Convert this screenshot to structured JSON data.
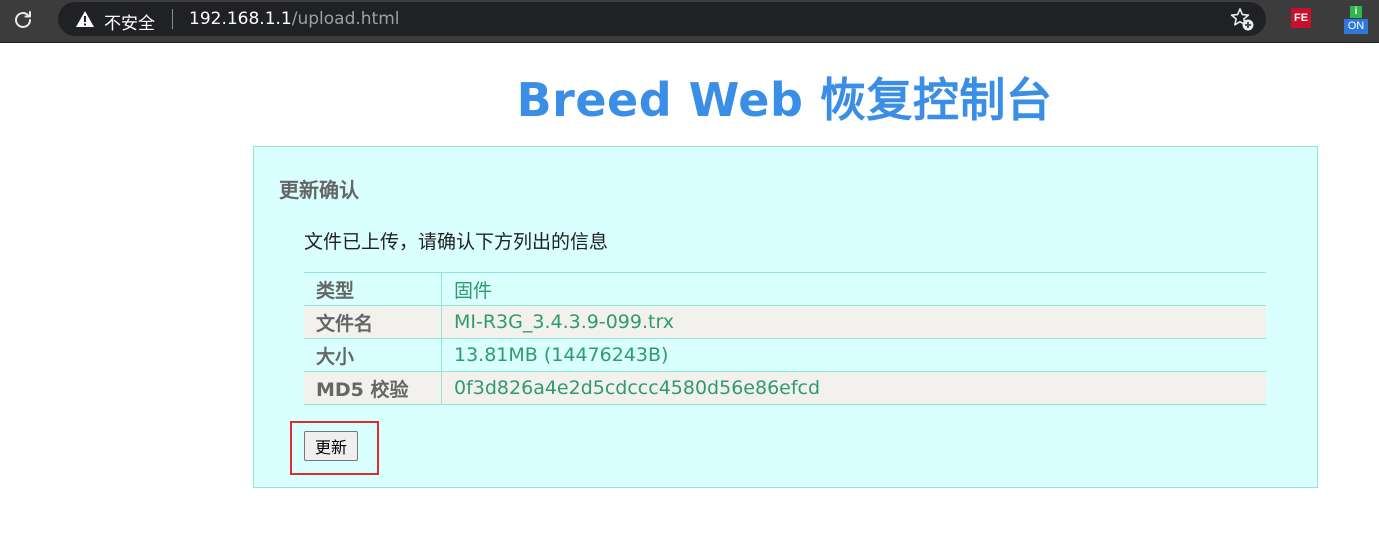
{
  "browser": {
    "security_label": "不安全",
    "url_host": "192.168.1.1",
    "url_path": "/upload.html",
    "extensions": [
      {
        "name": "fe-helper",
        "label": "FE"
      },
      {
        "name": "on-extension",
        "label": "ON"
      }
    ]
  },
  "page": {
    "title": "Breed Web 恢复控制台"
  },
  "panel": {
    "heading": "更新确认",
    "intro": "文件已上传，请确认下方列出的信息",
    "rows": [
      {
        "key": "类型",
        "value": "固件"
      },
      {
        "key": "文件名",
        "value": "MI-R3G_3.4.3.9-099.trx"
      },
      {
        "key": "大小",
        "value": "13.81MB (14476243B)"
      },
      {
        "key": "MD5 校验",
        "value": "0f3d826a4e2d5cdccc4580d56e86efcd"
      }
    ],
    "update_button": "更新"
  },
  "colors": {
    "title": "#3a8ee6",
    "panel_bg": "#d9ffff",
    "panel_border": "#8ee8d2",
    "value_text": "#2e9b6e",
    "highlight": "#d9302a"
  }
}
